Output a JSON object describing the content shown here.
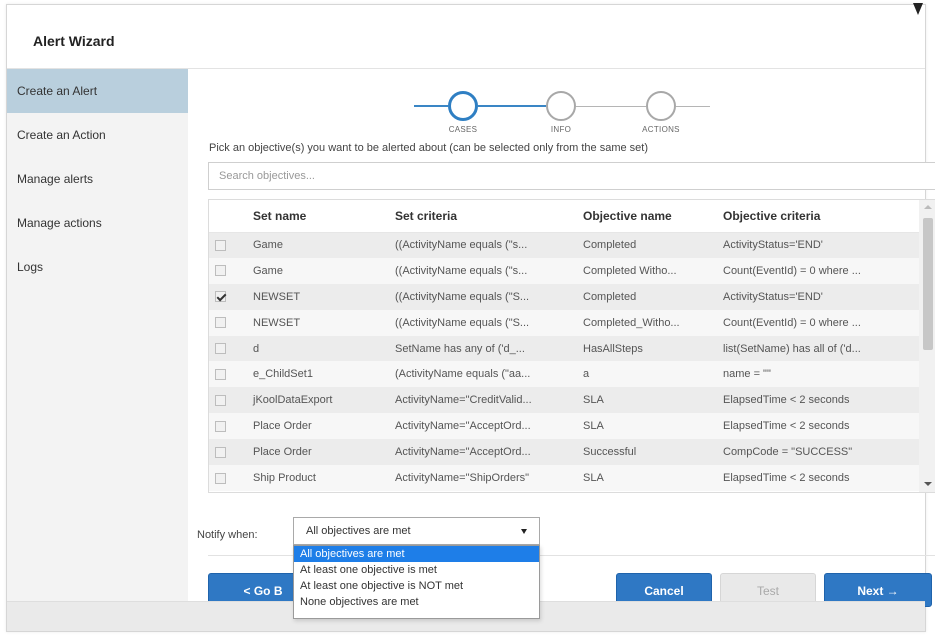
{
  "dialog": {
    "title": "Alert Wizard"
  },
  "sidebar": {
    "items": [
      {
        "label": "Create an Alert",
        "active": true
      },
      {
        "label": "Create an Action",
        "active": false
      },
      {
        "label": "Manage alerts",
        "active": false
      },
      {
        "label": "Manage actions",
        "active": false
      },
      {
        "label": "Logs",
        "active": false
      }
    ]
  },
  "stepper": {
    "steps": [
      {
        "label": "CASES",
        "state": "active"
      },
      {
        "label": "INFO",
        "state": "idle"
      },
      {
        "label": "ACTIONS",
        "state": "idle"
      }
    ],
    "accent_color": "#2f7fc3"
  },
  "instruction": "Pick an objective(s) you want to be alerted about (can be selected only from the same set)",
  "search": {
    "placeholder": "Search objectives...",
    "value": ""
  },
  "table": {
    "columns": [
      "",
      "Set name",
      "Set criteria",
      "Objective name",
      "Objective criteria"
    ],
    "rows": [
      {
        "checked": false,
        "set_name": "Game",
        "set_criteria": "((ActivityName equals (\"s...",
        "objective_name": "Completed",
        "objective_criteria": "ActivityStatus='END'"
      },
      {
        "checked": false,
        "set_name": "Game",
        "set_criteria": "((ActivityName equals (\"s...",
        "objective_name": "Completed Witho...",
        "objective_criteria": "Count(EventId) = 0 where ..."
      },
      {
        "checked": true,
        "set_name": "NEWSET",
        "set_criteria": "((ActivityName equals (\"S...",
        "objective_name": "Completed",
        "objective_criteria": "ActivityStatus='END'"
      },
      {
        "checked": false,
        "set_name": "NEWSET",
        "set_criteria": "((ActivityName equals (\"S...",
        "objective_name": "Completed_Witho...",
        "objective_criteria": "Count(EventId) = 0 where ..."
      },
      {
        "checked": false,
        "set_name": "d",
        "set_criteria": "SetName has any of ('d_...",
        "objective_name": "HasAllSteps",
        "objective_criteria": "list(SetName) has all of ('d..."
      },
      {
        "checked": false,
        "set_name": "e_ChildSet1",
        "set_criteria": "(ActivityName equals (\"aa...",
        "objective_name": "a",
        "objective_criteria": "name = \"\""
      },
      {
        "checked": false,
        "set_name": "jKoolDataExport",
        "set_criteria": "ActivityName=\"CreditValid...",
        "objective_name": "SLA",
        "objective_criteria": "ElapsedTime < 2 seconds"
      },
      {
        "checked": false,
        "set_name": "Place Order",
        "set_criteria": "ActivityName=\"AcceptOrd...",
        "objective_name": "SLA",
        "objective_criteria": "ElapsedTime < 2 seconds"
      },
      {
        "checked": false,
        "set_name": "Place Order",
        "set_criteria": "ActivityName=\"AcceptOrd...",
        "objective_name": "Successful",
        "objective_criteria": "CompCode = \"SUCCESS\""
      },
      {
        "checked": false,
        "set_name": "Ship Product",
        "set_criteria": "ActivityName=\"ShipOrders\"",
        "objective_name": "SLA",
        "objective_criteria": "ElapsedTime < 2 seconds"
      }
    ]
  },
  "notify": {
    "label": "Notify when:",
    "selected": "All objectives are met",
    "options": [
      "All objectives are met",
      "At least one objective is met",
      "At least one objective is NOT met",
      "None objectives are met"
    ]
  },
  "buttons": {
    "go_back": "< Go B",
    "cancel": "Cancel",
    "test": "Test",
    "next": "Next →"
  },
  "colors": {
    "primary_button": "#2f78c4",
    "sidebar_active": "#b9cfdd",
    "dropdown_highlight": "#1e7ee8"
  }
}
